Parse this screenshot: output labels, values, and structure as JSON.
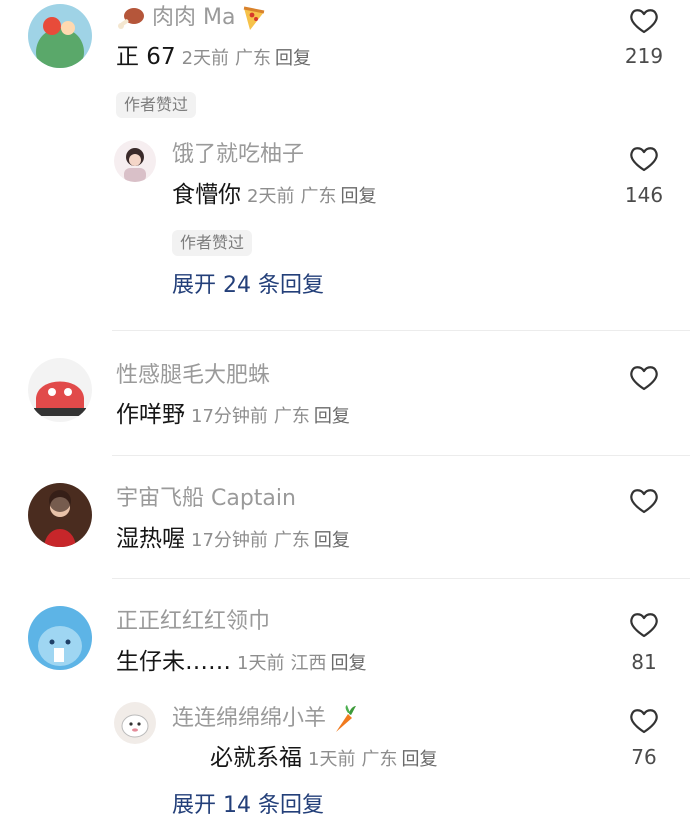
{
  "comments": [
    {
      "name": "肉肉 Ma",
      "text": "正 67",
      "time": "2天前",
      "region": "广东",
      "reply_label": "回复",
      "likes": "219",
      "badge": "作者赞过",
      "reply": {
        "name": "饿了就吃柚子",
        "text": "食懵你",
        "time": "2天前",
        "region": "广东",
        "reply_label": "回复",
        "likes": "146",
        "badge": "作者赞过"
      },
      "expand": "展开 24 条回复"
    },
    {
      "name": "性感腿毛大肥蛛",
      "text": "作咩野",
      "time": "17分钟前",
      "region": "广东",
      "reply_label": "回复",
      "likes": ""
    },
    {
      "name": "宇宙飞船 Captain",
      "text": "湿热喔",
      "time": "17分钟前",
      "region": "广东",
      "reply_label": "回复",
      "likes": ""
    },
    {
      "name": "正正红红红领巾",
      "text": "生仔未……",
      "time": "1天前",
      "region": "江西",
      "reply_label": "回复",
      "likes": "81",
      "reply": {
        "name": "连连绵绵绵小羊",
        "text": "必就系福",
        "time": "1天前",
        "region": "广东",
        "reply_label": "回复",
        "likes": "76"
      },
      "expand": "展开 14 条回复"
    }
  ],
  "icons": {
    "like": "heart-outline-icon",
    "emoji_meat": "meat-on-bone-emoji",
    "emoji_pizza": "pizza-emoji",
    "emoji_carrot": "carrot-emoji"
  },
  "colors": {
    "name": "#9a9a9a",
    "text": "#161616",
    "link": "#233f79",
    "badge_bg": "#f2f2f2"
  }
}
